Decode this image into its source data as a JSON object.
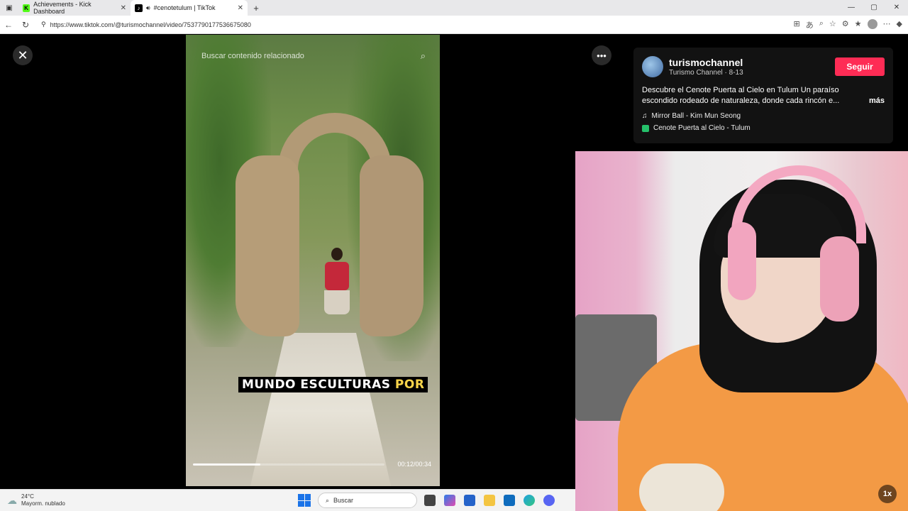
{
  "browser": {
    "tabs": [
      {
        "label": "Achievements - Kick Dashboard",
        "favicon": "K"
      },
      {
        "label": "#cenotetulum | TikTok",
        "favicon": "♪"
      }
    ],
    "new_tab": "+",
    "url": "https://www.tiktok.com/@turismochannel/video/7537790177536675080",
    "window_controls": [
      "—",
      "▢",
      "✕"
    ]
  },
  "video": {
    "search_placeholder": "Buscar contenido relacionado",
    "caption_main": "MUNDO ESCULTURAS",
    "caption_highlight": "POR",
    "time": "00:12/00:34",
    "progress": 0.35
  },
  "post": {
    "author": "turismochannel",
    "author_sub": "Turismo Channel · 8-13",
    "follow_label": "Seguir",
    "description": "Descubre el Cenote Puerta al Cielo en Tulum Un paraíso escondido rodeado de naturaleza, donde cada rincón e...",
    "more_label": "más",
    "music": "Mirror Ball - Kim Mun Seong",
    "location": "Cenote Puerta al Cielo - Tulum"
  },
  "webcam": {
    "speed_label": "1x"
  },
  "taskbar": {
    "temperature": "24°C",
    "weather": "Mayorm. nublado",
    "search_label": "Buscar"
  },
  "colors": {
    "follow": "#fe2c55",
    "caption_highlight": "#f7d44a",
    "kick_green": "#53fc18"
  }
}
